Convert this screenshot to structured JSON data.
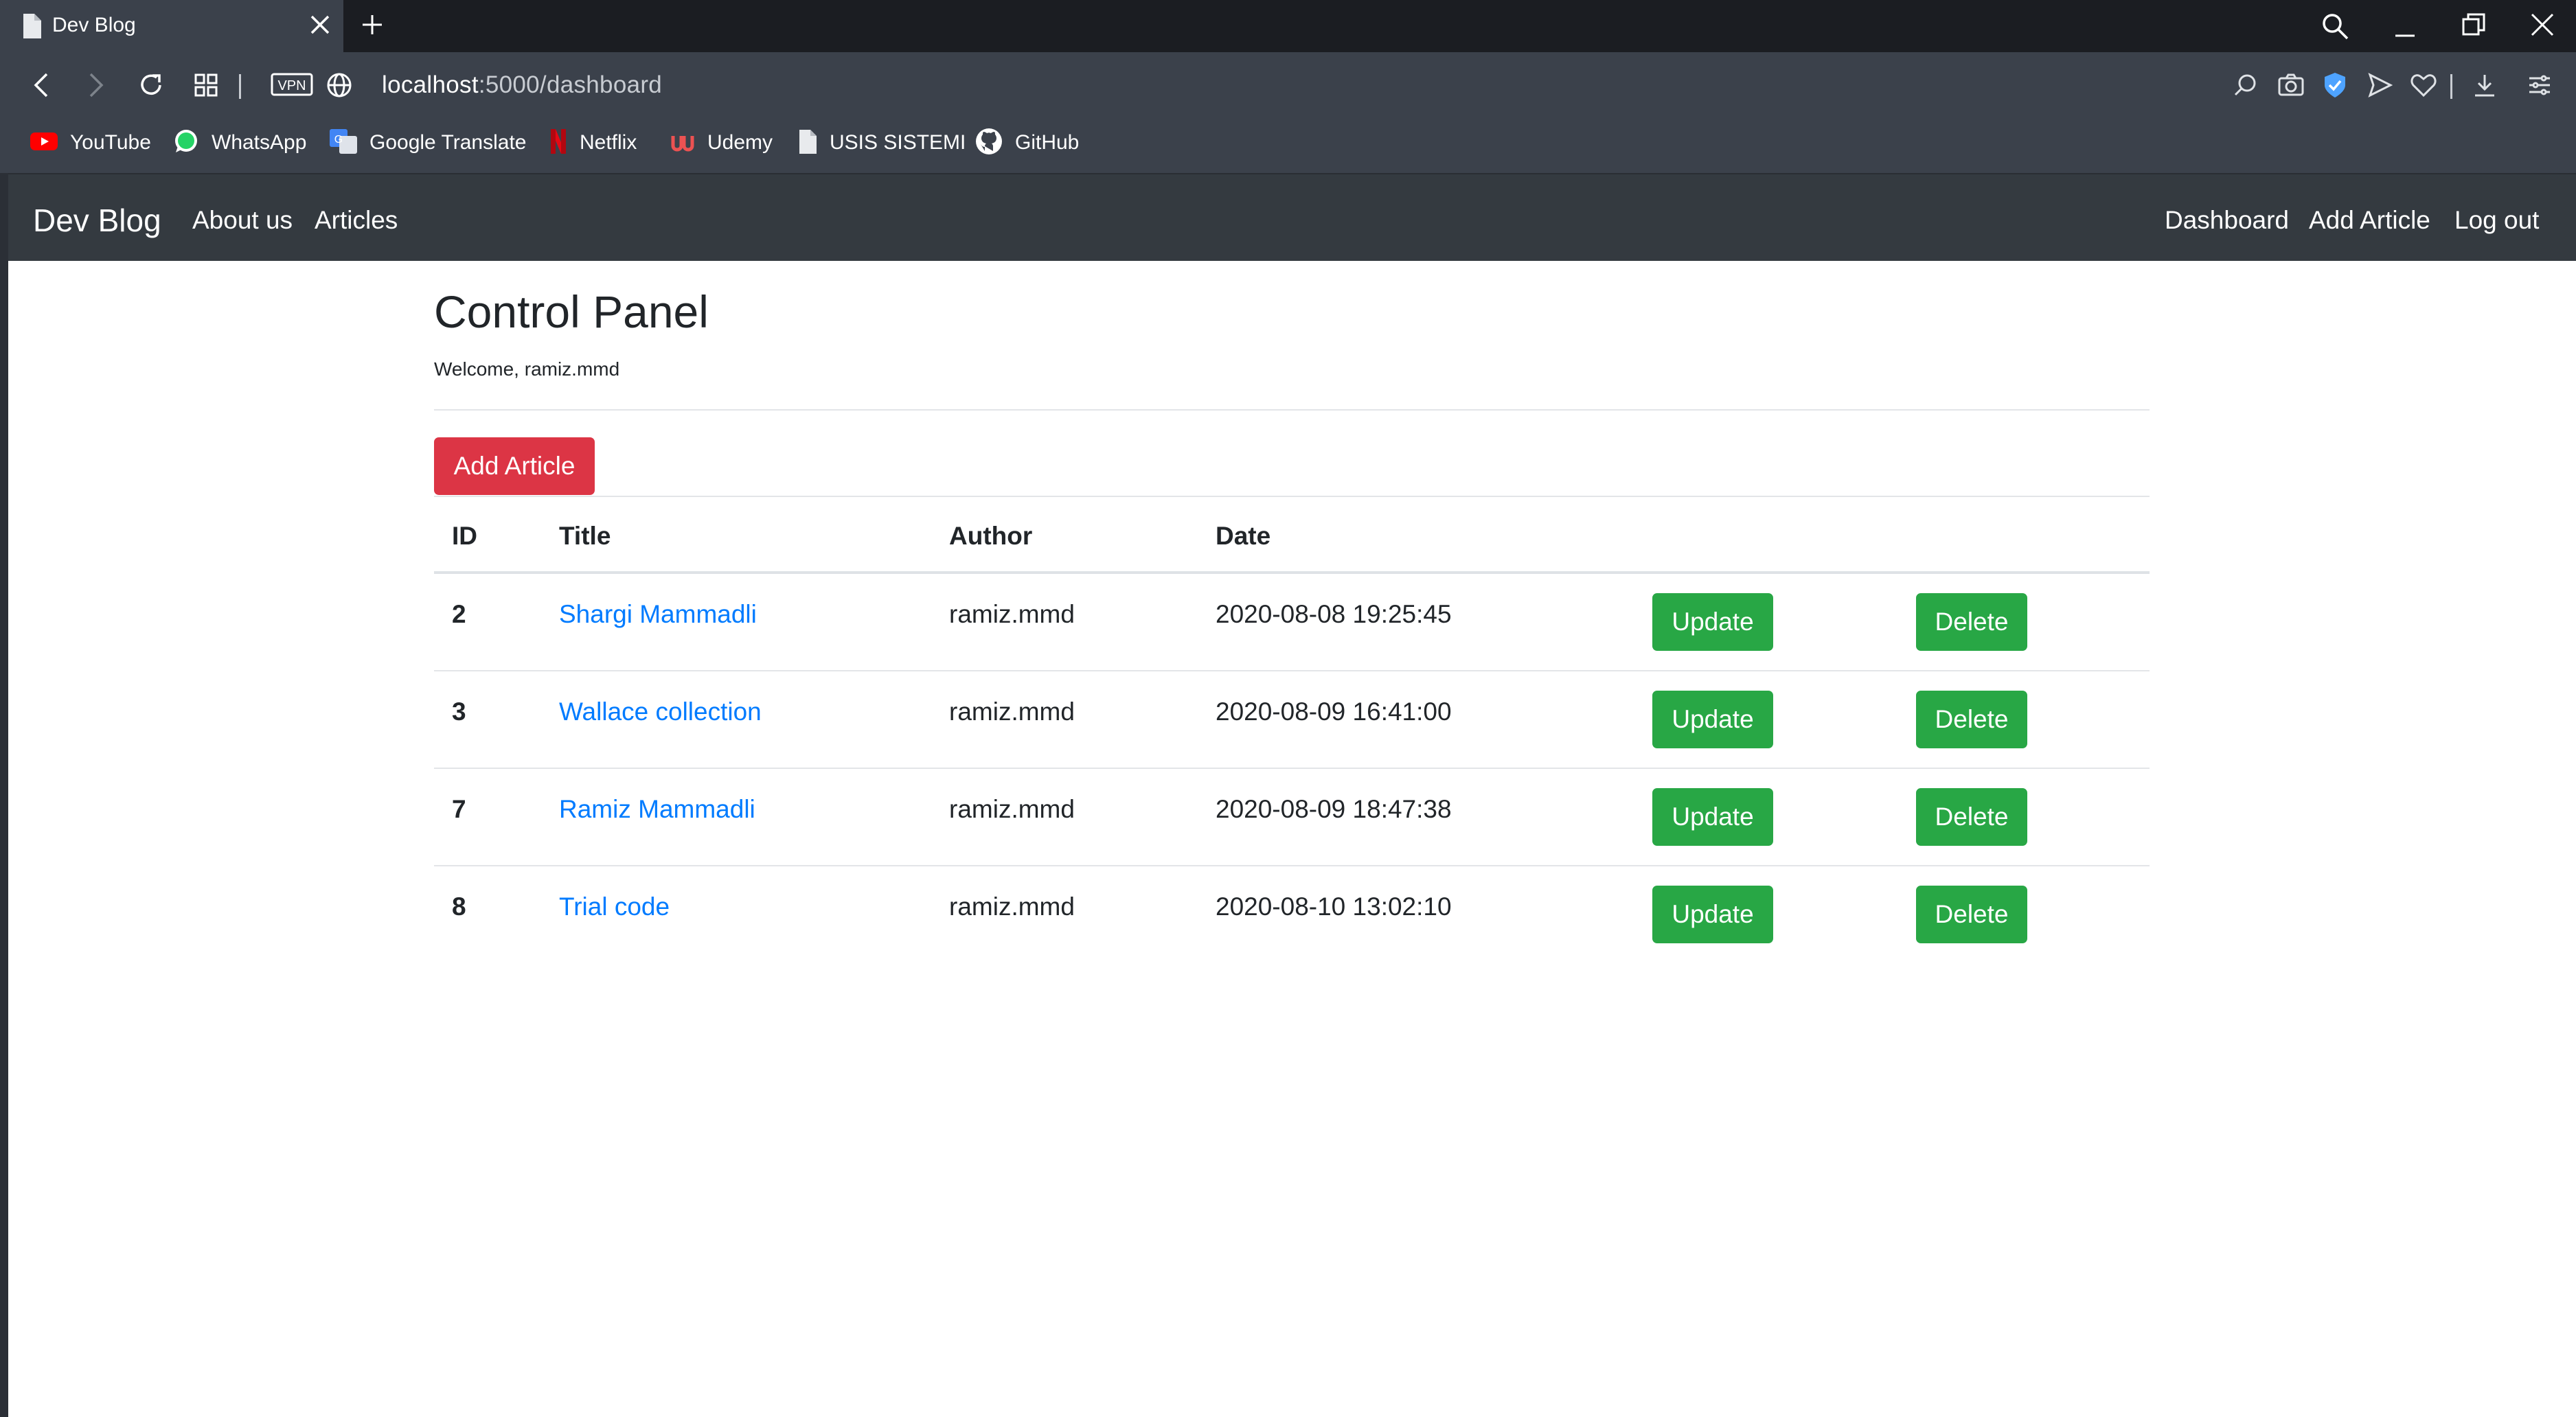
{
  "browser": {
    "tab_title": "Dev Blog",
    "url_host": "localhost",
    "url_path": ":5000/dashboard",
    "vpn_label": "VPN",
    "accent": "#3b414b",
    "bookmarks": [
      {
        "label": "YouTube",
        "icon": "youtube-icon"
      },
      {
        "label": "WhatsApp",
        "icon": "whatsapp-icon"
      },
      {
        "label": "Google Translate",
        "icon": "google-translate-icon"
      },
      {
        "label": "Netflix",
        "icon": "netflix-icon"
      },
      {
        "label": "Udemy",
        "icon": "udemy-icon"
      },
      {
        "label": "USIS SISTEMI",
        "icon": "document-icon"
      },
      {
        "label": "GitHub",
        "icon": "github-icon"
      }
    ]
  },
  "navbar": {
    "brand": "Dev Blog",
    "left_links": [
      "About us",
      "Articles"
    ],
    "right_links": [
      "Dashboard",
      "Add Article",
      "Log out"
    ],
    "background": "#343a40"
  },
  "main": {
    "title": "Control Panel",
    "welcome": "Welcome, ramiz.mmd",
    "add_button": "Add Article",
    "table": {
      "headers": [
        "ID",
        "Title",
        "Author",
        "Date"
      ],
      "rows": [
        {
          "id": "2",
          "title": "Shargi Mammadli",
          "author": "ramiz.mmd",
          "date": "2020-08-08 19:25:45",
          "update": "Update",
          "delete": "Delete"
        },
        {
          "id": "3",
          "title": "Wallace collection",
          "author": "ramiz.mmd",
          "date": "2020-08-09 16:41:00",
          "update": "Update",
          "delete": "Delete"
        },
        {
          "id": "7",
          "title": "Ramiz Mammadli",
          "author": "ramiz.mmd",
          "date": "2020-08-09 18:47:38",
          "update": "Update",
          "delete": "Delete"
        },
        {
          "id": "8",
          "title": "Trial code",
          "author": "ramiz.mmd",
          "date": "2020-08-10 13:02:10",
          "update": "Update",
          "delete": "Delete"
        }
      ]
    },
    "colors": {
      "danger": "#dc3545",
      "success": "#28a745",
      "link": "#007bff"
    }
  }
}
